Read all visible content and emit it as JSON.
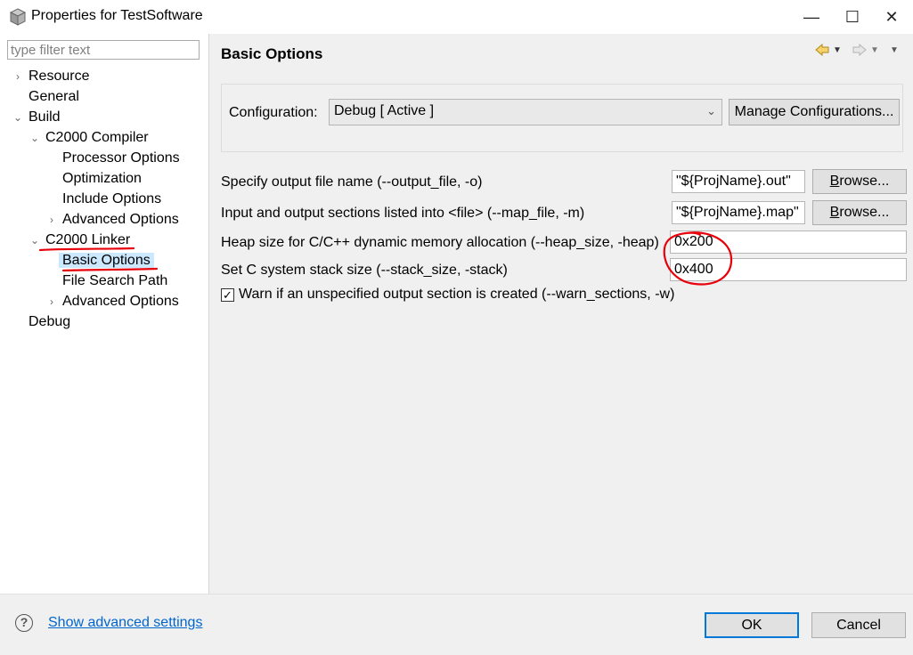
{
  "window": {
    "title": "Properties for TestSoftware",
    "minimize_glyph": "—",
    "maximize_glyph": "☐",
    "close_glyph": "✕"
  },
  "filter": {
    "placeholder": "type filter text"
  },
  "tree": {
    "resource": "Resource",
    "general": "General",
    "build": "Build",
    "compiler": "C2000 Compiler",
    "processor_options": "Processor Options",
    "optimization": "Optimization",
    "include_options": "Include Options",
    "compiler_advanced": "Advanced Options",
    "linker": "C2000 Linker",
    "basic_options": "Basic Options",
    "file_search_path": "File Search Path",
    "linker_advanced": "Advanced Options",
    "debug": "Debug"
  },
  "page": {
    "title": "Basic Options"
  },
  "configuration": {
    "label": "Configuration:",
    "value": "Debug  [ Active ]",
    "manage_button": "Manage Configurations..."
  },
  "options": {
    "output_file": {
      "label": "Specify output file name (--output_file, -o)",
      "value": "\"${ProjName}.out\"",
      "browse": "rowse...",
      "browse_mnemonic": "B"
    },
    "map_file": {
      "label": "Input and output sections listed into <file> (--map_file, -m)",
      "value": "\"${ProjName}.map\"",
      "browse": "rowse...",
      "browse_mnemonic": "B"
    },
    "heap_size": {
      "label": "Heap size for C/C++ dynamic memory allocation (--heap_size, -heap)",
      "value": "0x200"
    },
    "stack_size": {
      "label": "Set C system stack size (--stack_size, -stack)",
      "value": "0x400"
    },
    "warn_sections": {
      "label": "Warn if an unspecified output section is created (--warn_sections, -w)",
      "checked": true,
      "check_glyph": "✓"
    }
  },
  "footer": {
    "help_glyph": "?",
    "advanced_link": "Show advanced settings",
    "ok": "OK",
    "cancel": "Cancel"
  },
  "colors": {
    "selection": "#cce8ff",
    "link": "#0066cc",
    "annotation_red": "#e8000b",
    "default_button_border": "#0078d7"
  },
  "icons": {
    "app": "cube-icon",
    "back": "arrow-left-icon",
    "forward": "arrow-right-icon",
    "dropdown": "chevron-down-icon",
    "help": "question-circle-icon"
  }
}
